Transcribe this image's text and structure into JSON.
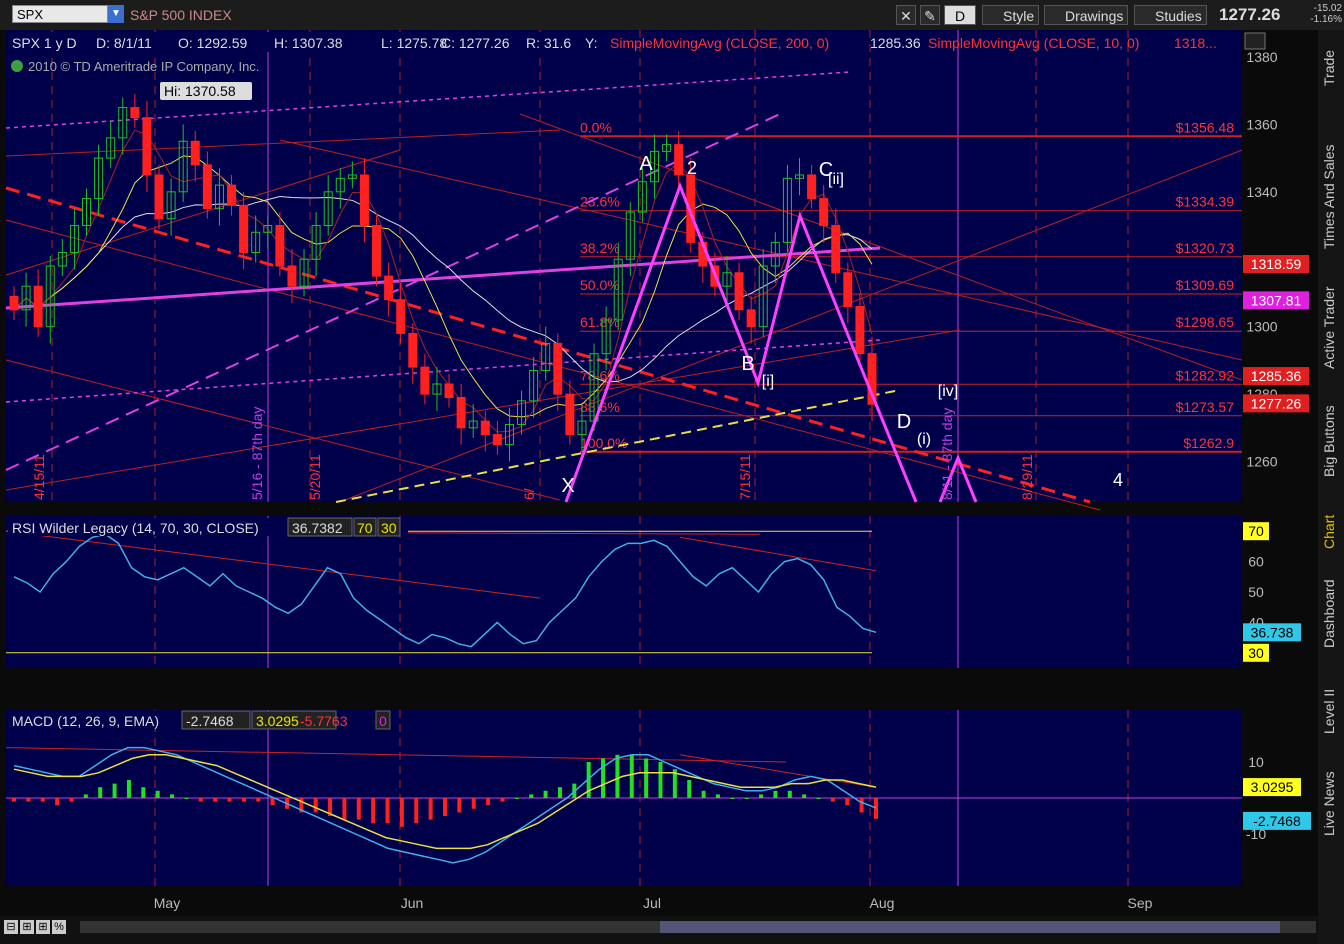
{
  "toolbar": {
    "symbol": "SPX",
    "name": "S&P 500 INDEX",
    "period": "D",
    "style_label": "Style",
    "drawings_label": "Drawings",
    "studies_label": "Studies",
    "price": "1277.26",
    "change": "-15.02",
    "change_pct": "-1.16%"
  },
  "sidebar": {
    "tabs": [
      "Trade",
      "Times And Sales",
      "Active Trader",
      "Big Buttons",
      "Chart",
      "Dashboard",
      "Level II",
      "Live News"
    ],
    "active": "Chart"
  },
  "price_panel": {
    "info": [
      "SPX 1 y D",
      "D: 8/1/11",
      "O: 1292.59",
      "H: 1307.38",
      "L: 1275.78",
      "C: 1277.26",
      "R: 31.6",
      "Y:"
    ],
    "sma200_label": "SimpleMovingAvg (CLOSE, 200, 0)",
    "sma200_value": "1285.36",
    "sma10_label": "SimpleMovingAvg (CLOSE, 10, 0)",
    "sma10_value": "1318...",
    "copyright": "2010 © TD Ameritrade IP Company, Inc.",
    "hi_label": "Hi: 1370.58"
  },
  "rsi_panel": {
    "label": "RSI Wilder Legacy (14, 70, 30, CLOSE)",
    "value": "36.7382",
    "ob": "70",
    "os": "30",
    "value_badge": "36.738"
  },
  "macd_panel": {
    "label": "MACD (12, 26, 9, EMA)",
    "v1": "-2.7468",
    "v2": "3.0295",
    "v3": "-5.7763",
    "v4": "0",
    "badge_signal": "3.0295",
    "badge_macd": "-2.7468"
  },
  "fib_levels": [
    {
      "label": "0.0%",
      "price": "$1356.48",
      "value": 1356.48
    },
    {
      "label": "23.6%",
      "price": "$1334.39",
      "value": 1334.39
    },
    {
      "label": "38.2%",
      "price": "$1320.73",
      "value": 1320.73
    },
    {
      "label": "50.0%",
      "price": "$1309.69",
      "value": 1309.69
    },
    {
      "label": "61.8%",
      "price": "$1298.65",
      "value": 1298.65
    },
    {
      "label": "78.6%",
      "price": "$1282.92",
      "value": 1282.92
    },
    {
      "label": "88.6%",
      "price": "$1273.57",
      "value": 1273.57
    },
    {
      "label": "100.0%",
      "price": "$1262.9",
      "value": 1262.9
    }
  ],
  "right_badges": [
    {
      "text": "1318.59",
      "value": 1318.59,
      "color": "#e02020"
    },
    {
      "text": "1307.81",
      "value": 1307.81,
      "color": "#e020e0"
    },
    {
      "text": "1285.36",
      "value": 1285.36,
      "color": "#e02020"
    },
    {
      "text": "1277.26",
      "value": 1277.26,
      "color": "#e02020"
    }
  ],
  "wave_labels": [
    "X",
    "A",
    "2",
    "B",
    "[i]",
    "[ii]",
    "C",
    "D",
    "(i)",
    "[iv]",
    "4"
  ],
  "vertical_labels": [
    "4/15/11",
    "5/16 - 87th day",
    "5/20/11",
    "6/",
    "7/15/11",
    "8/11 - 87th day",
    "8/29/11"
  ],
  "chart_data": {
    "type": "candlestick",
    "title": "SPX 1 y D",
    "x_months": [
      "May",
      "Jun",
      "Jul",
      "Aug",
      "Sep"
    ],
    "y_ticks": [
      1260,
      1280,
      1300,
      1320,
      1340,
      1360,
      1380
    ],
    "ylim": [
      1248,
      1388
    ],
    "rsi_ticks": [
      30,
      40,
      50,
      60,
      70
    ],
    "macd_ticks": [
      -10,
      0,
      10
    ],
    "ohlc_close_series": [
      1305,
      1312,
      1300,
      1318,
      1322,
      1330,
      1338,
      1350,
      1356,
      1365,
      1362,
      1345,
      1332,
      1340,
      1355,
      1348,
      1335,
      1342,
      1336,
      1322,
      1328,
      1330,
      1318,
      1312,
      1320,
      1330,
      1340,
      1344,
      1345,
      1330,
      1315,
      1308,
      1298,
      1288,
      1280,
      1283,
      1279,
      1270,
      1272,
      1268,
      1265,
      1271,
      1278,
      1287,
      1295,
      1280,
      1268,
      1272,
      1292,
      1302,
      1320,
      1334,
      1343,
      1352,
      1354,
      1345,
      1325,
      1318,
      1312,
      1316,
      1305,
      1300,
      1318,
      1325,
      1344,
      1345,
      1338,
      1330,
      1316,
      1306,
      1292,
      1277
    ],
    "rsi_values": [
      55,
      53,
      50,
      56,
      60,
      65,
      68,
      69,
      66,
      58,
      55,
      54,
      56,
      58,
      55,
      52,
      56,
      52,
      50,
      48,
      45,
      43,
      46,
      52,
      58,
      56,
      48,
      44,
      41,
      38,
      35,
      33,
      36,
      35,
      33,
      32,
      36,
      40,
      36,
      33,
      34,
      40,
      44,
      48,
      55,
      60,
      64,
      66,
      66,
      67,
      65,
      60,
      55,
      52,
      56,
      58,
      54,
      50,
      56,
      60,
      61,
      59,
      54,
      45,
      42,
      38,
      36.74
    ],
    "macd_hist": [
      -1,
      -1,
      -1,
      -2,
      -1,
      1,
      3,
      4,
      5,
      3,
      2,
      1,
      0,
      -1,
      -1,
      -1,
      -1,
      -1,
      -2,
      -3,
      -4,
      -4,
      -5,
      -6,
      -6,
      -7,
      -7,
      -8,
      -7,
      -6,
      -5,
      -4,
      -3,
      -2,
      -1,
      0,
      1,
      2,
      3,
      4,
      10,
      11,
      12,
      12,
      11,
      10,
      8,
      5,
      2,
      1,
      0,
      0,
      1,
      2,
      2,
      1,
      0,
      -1,
      -2,
      -4,
      -5.78
    ],
    "macd_line": [
      9,
      8,
      7,
      6,
      6,
      9,
      12,
      14,
      14,
      13,
      12,
      10,
      8,
      6,
      4,
      2,
      0,
      -2,
      -4,
      -6,
      -8,
      -10,
      -12,
      -14,
      -15,
      -16,
      -17,
      -18,
      -17,
      -15,
      -12,
      -9,
      -6,
      -3,
      0,
      4,
      8,
      11,
      12,
      12,
      10,
      8,
      6,
      4,
      3,
      2,
      2,
      3,
      5,
      6,
      5,
      2,
      -1,
      -2.75
    ],
    "signal_line": [
      8,
      7,
      6,
      6,
      6,
      7,
      9,
      11,
      12,
      12,
      11,
      10,
      9,
      7,
      5,
      3,
      1,
      -1,
      -3,
      -5,
      -7,
      -9,
      -11,
      -12,
      -13,
      -14,
      -14,
      -14,
      -13,
      -11,
      -9,
      -7,
      -4,
      -1,
      2,
      4,
      6,
      7,
      7,
      7,
      6,
      5,
      4,
      3,
      3,
      3,
      4,
      4,
      5,
      5,
      4,
      3.03
    ]
  }
}
